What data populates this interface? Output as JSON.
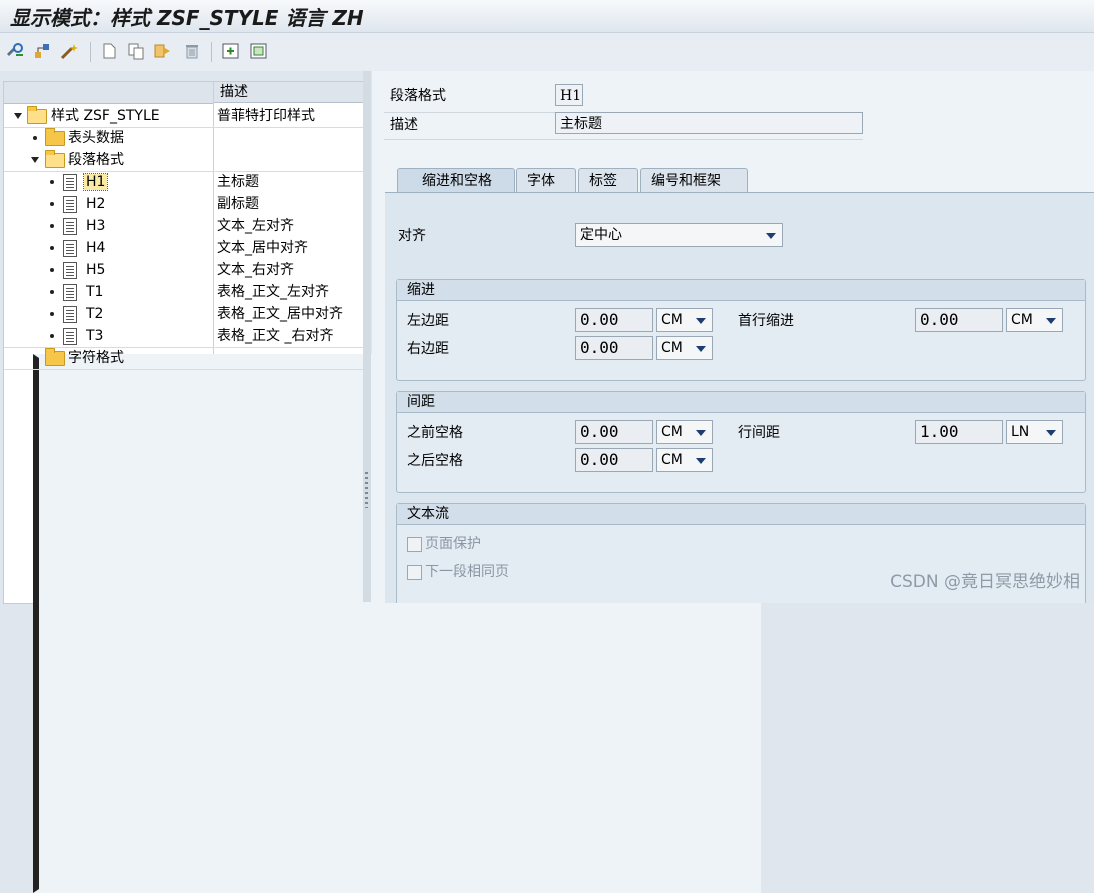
{
  "window": {
    "title": "显示模式：样式 ZSF_STYLE 语言 ZH"
  },
  "toolbar": {
    "buttons": [
      "other-object-icon",
      "hierarchy-icon",
      "magic-wand-icon",
      "new-doc-icon",
      "copy-icon",
      "transport-icon",
      "delete-icon",
      "expand-icon",
      "collapse-icon"
    ]
  },
  "tree": {
    "header_desc": "描述",
    "rows": [
      {
        "name": "样式 ZSF_STYLE",
        "desc": "普菲特打印样式"
      },
      {
        "name": "表头数据",
        "desc": ""
      },
      {
        "name": "段落格式",
        "desc": ""
      },
      {
        "name": "H1",
        "desc": "主标题"
      },
      {
        "name": "H2",
        "desc": "副标题"
      },
      {
        "name": "H3",
        "desc": "文本_左对齐"
      },
      {
        "name": "H4",
        "desc": "文本_居中对齐"
      },
      {
        "name": "H5",
        "desc": "文本_右对齐"
      },
      {
        "name": "T1",
        "desc": "表格_正文_左对齐"
      },
      {
        "name": "T2",
        "desc": "表格_正文_居中对齐"
      },
      {
        "name": "T3",
        "desc": "表格_正文 _右对齐"
      },
      {
        "name": "字符格式",
        "desc": ""
      }
    ]
  },
  "detail": {
    "para_label": "段落格式",
    "para_value": "H1",
    "desc_label": "描述",
    "desc_value": "主标题"
  },
  "tabs": [
    "缩进和空格",
    "字体",
    "标签",
    "编号和框架"
  ],
  "align": {
    "label": "对齐",
    "value": "定中心"
  },
  "indent": {
    "title": "缩进",
    "left_label": "左边距",
    "left_value": "0.00",
    "left_unit": "CM",
    "right_label": "右边距",
    "right_value": "0.00",
    "right_unit": "CM",
    "first_label": "首行缩进",
    "first_value": "0.00",
    "first_unit": "CM"
  },
  "spacing": {
    "title": "间距",
    "before_label": "之前空格",
    "before_value": "0.00",
    "before_unit": "CM",
    "after_label": "之后空格",
    "after_value": "0.00",
    "after_unit": "CM",
    "line_label": "行间距",
    "line_value": "1.00",
    "line_unit": "LN"
  },
  "textflow": {
    "title": "文本流",
    "page_protect": "页面保护",
    "same_page": "下一段相同页"
  },
  "watermark": "CSDN @竟日冥思绝妙相"
}
